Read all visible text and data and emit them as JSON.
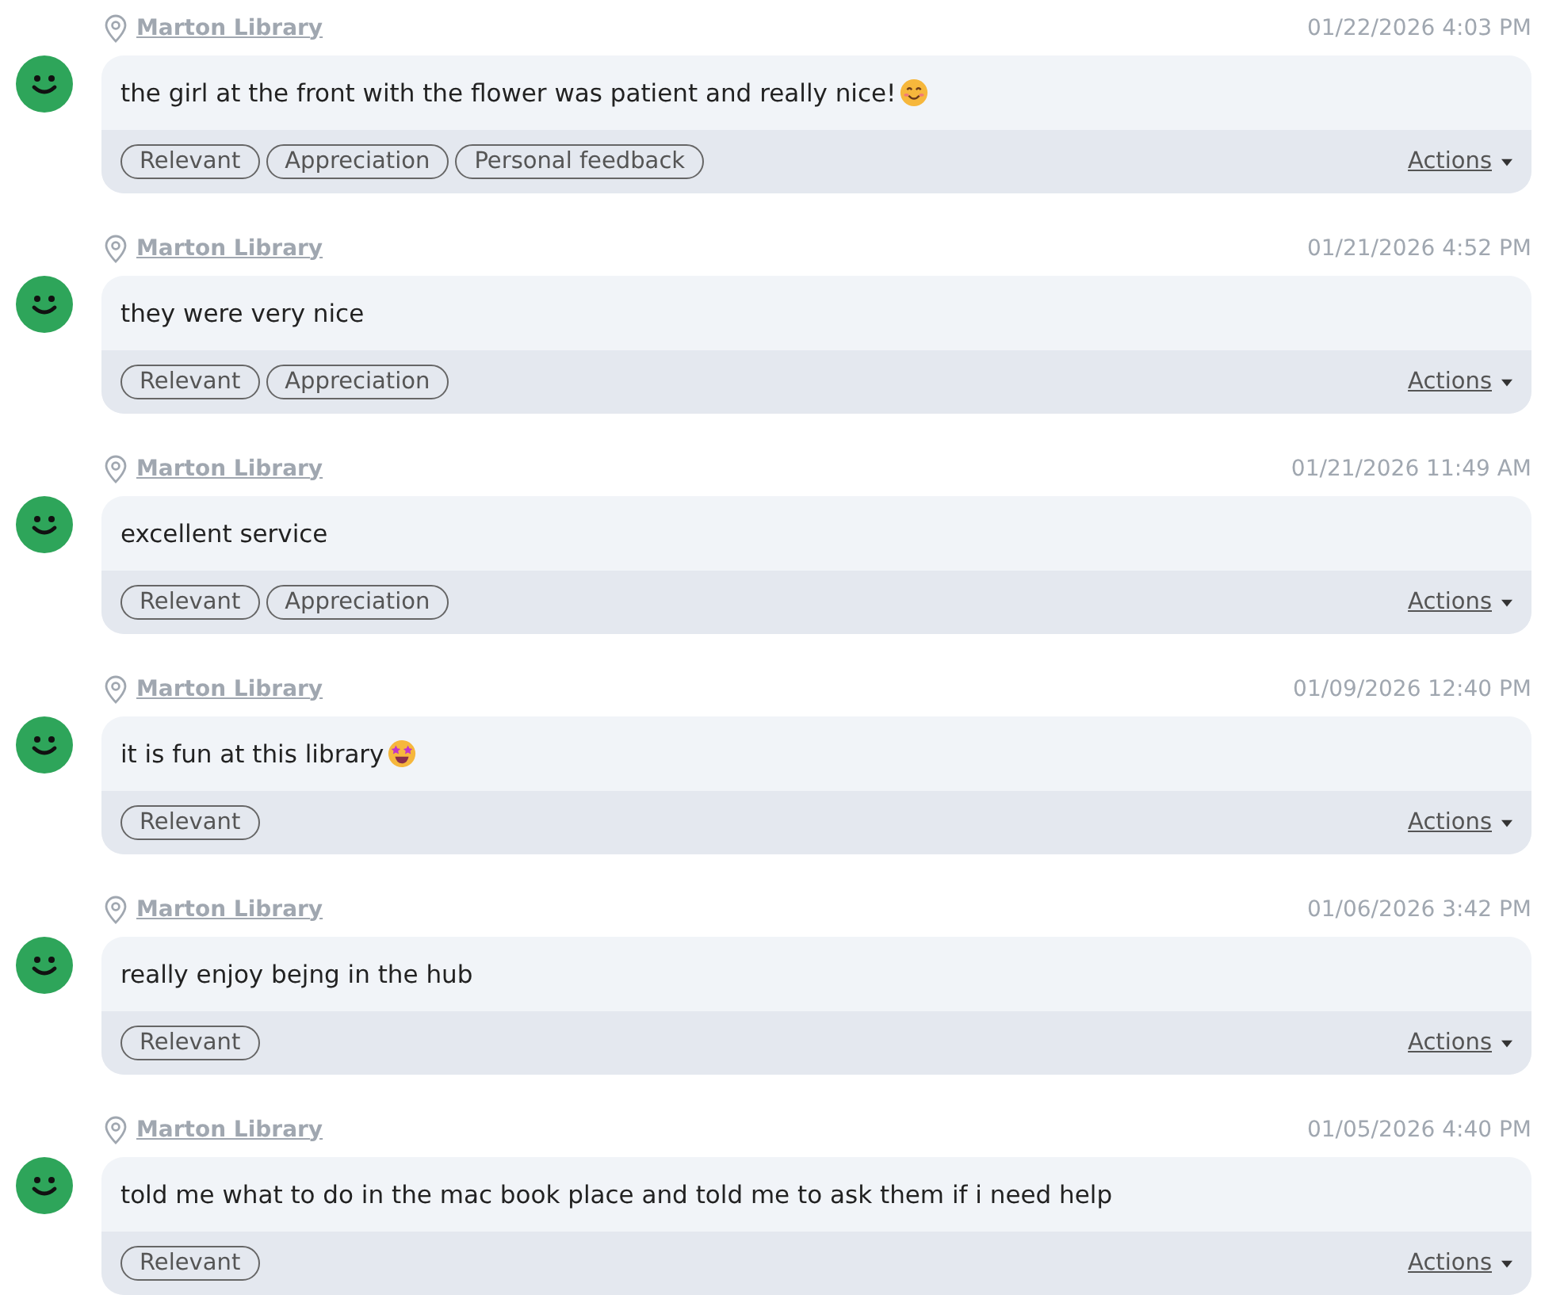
{
  "feedback": [
    {
      "location": "Marton Library",
      "timestamp": "01/22/2026 4:03 PM",
      "message": "the girl at the front with the flower was patient and really nice!",
      "emoji": {
        "kind": "smile"
      },
      "tags": [
        "Relevant",
        "Appreciation",
        "Personal feedback"
      ],
      "actions": "Actions"
    },
    {
      "location": "Marton Library",
      "timestamp": "01/21/2026 4:52 PM",
      "message": "they were very nice",
      "tags": [
        "Relevant",
        "Appreciation"
      ],
      "actions": "Actions"
    },
    {
      "location": "Marton Library",
      "timestamp": "01/21/2026 11:49 AM",
      "message": "excellent service",
      "tags": [
        "Relevant",
        "Appreciation"
      ],
      "actions": "Actions"
    },
    {
      "location": "Marton Library",
      "timestamp": "01/09/2026 12:40 PM",
      "message": "it is fun at this library",
      "emoji": {
        "kind": "star_eyes"
      },
      "tags": [
        "Relevant"
      ],
      "actions": "Actions"
    },
    {
      "location": "Marton Library",
      "timestamp": "01/06/2026 3:42 PM",
      "message": "really enjoy bejng in the hub",
      "tags": [
        "Relevant"
      ],
      "actions": "Actions"
    },
    {
      "location": "Marton Library",
      "timestamp": "01/05/2026 4:40 PM",
      "message": "told me what to do in the mac book place and told me to ask them if i need help",
      "tags": [
        "Relevant"
      ],
      "actions": "Actions"
    }
  ]
}
